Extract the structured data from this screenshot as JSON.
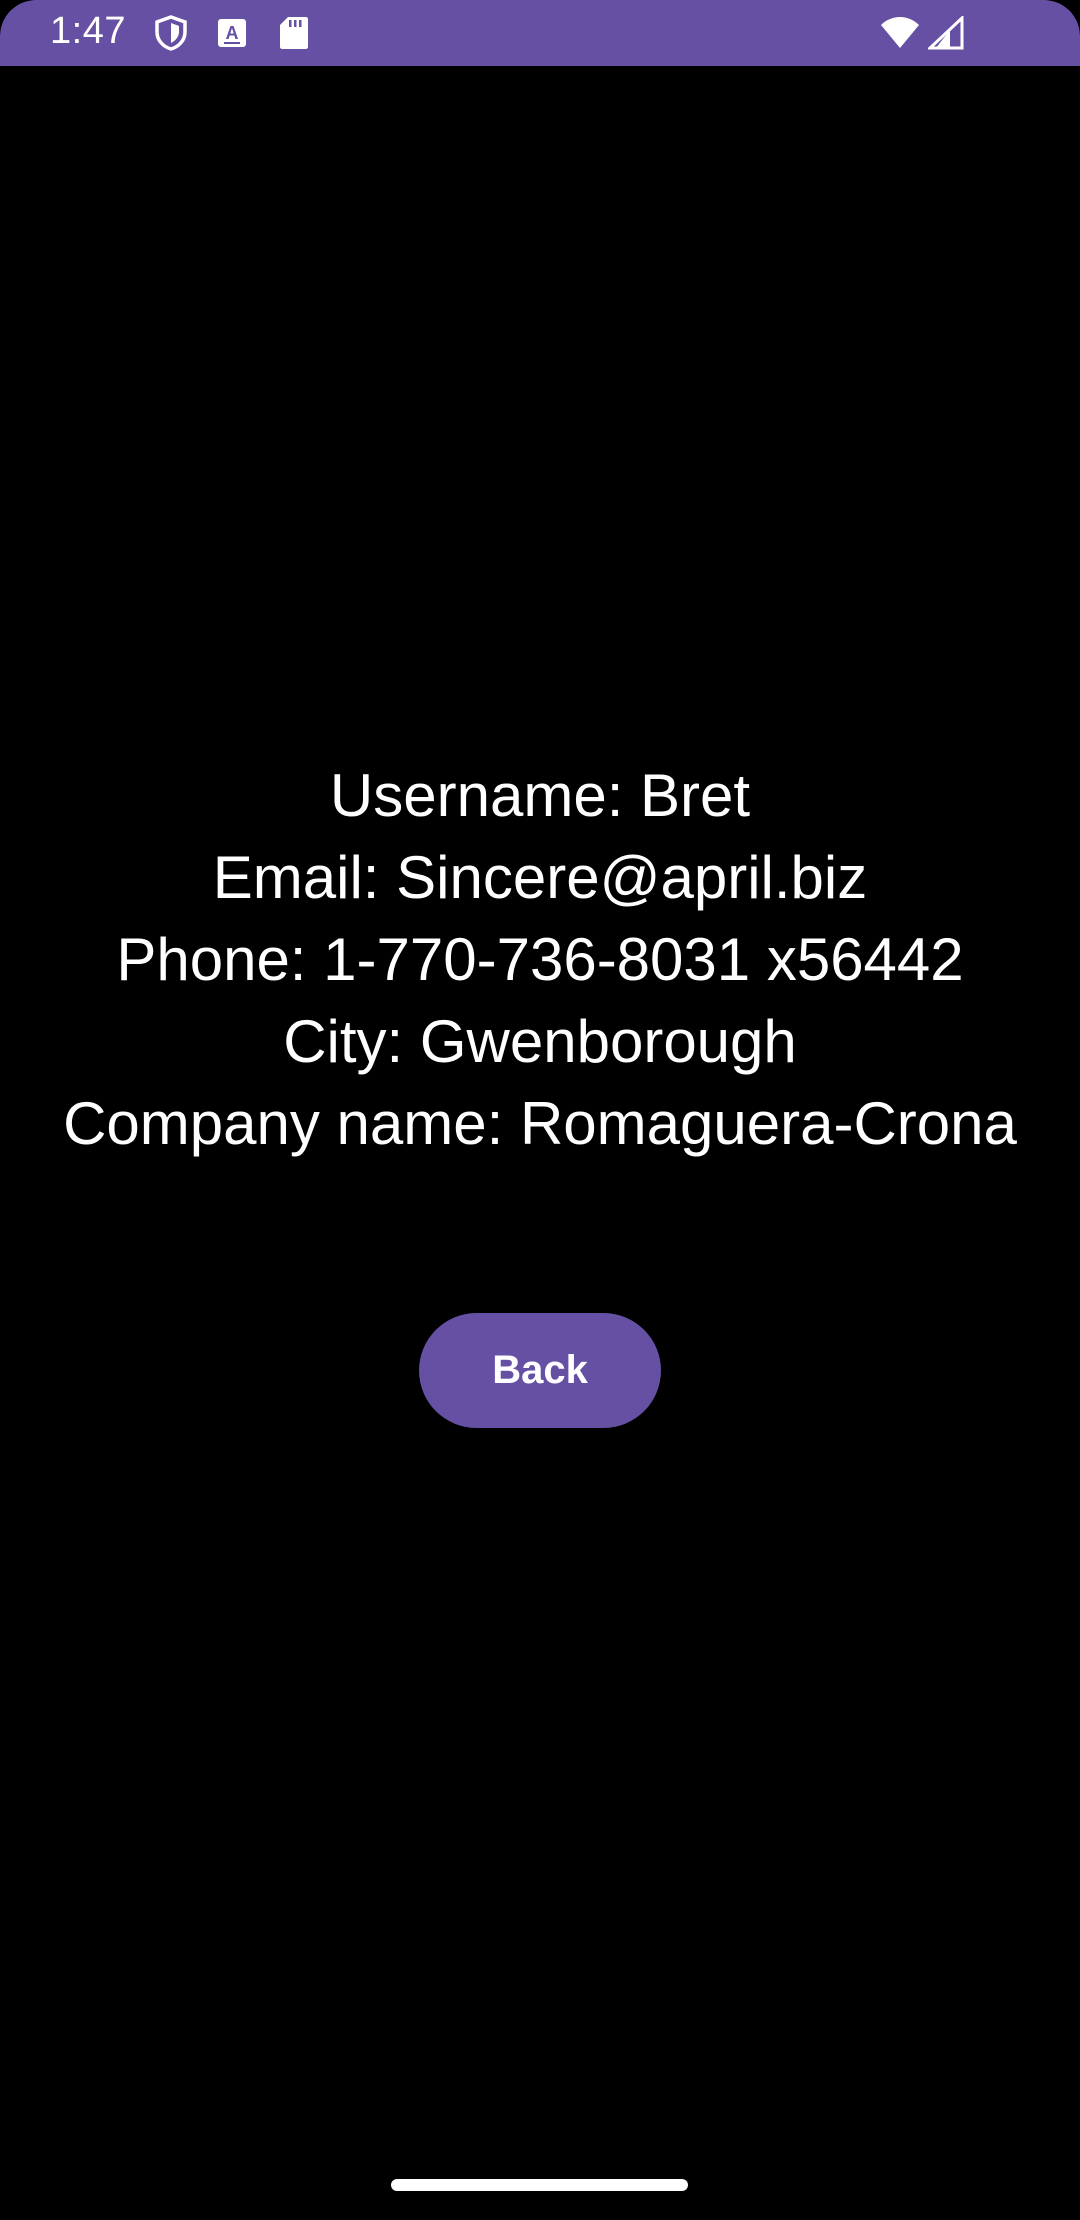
{
  "status_bar": {
    "time": "1:47",
    "background_color": "#6650a4",
    "left_icons": [
      "shield-icon",
      "a-notification-icon",
      "sd-card-icon"
    ],
    "right_icons": [
      "wifi-icon",
      "signal-icon"
    ]
  },
  "details": {
    "username": "Username: Bret",
    "email": "Email: Sincere@april.biz",
    "phone": "Phone: 1-770-736-8031 x56442",
    "city": "City: Gwenborough",
    "company": "Company name: Romaguera-Crona"
  },
  "actions": {
    "back_label": "Back",
    "button_color": "#6650a4"
  },
  "theme": {
    "background": "#000000",
    "text_color": "#ffffff"
  }
}
